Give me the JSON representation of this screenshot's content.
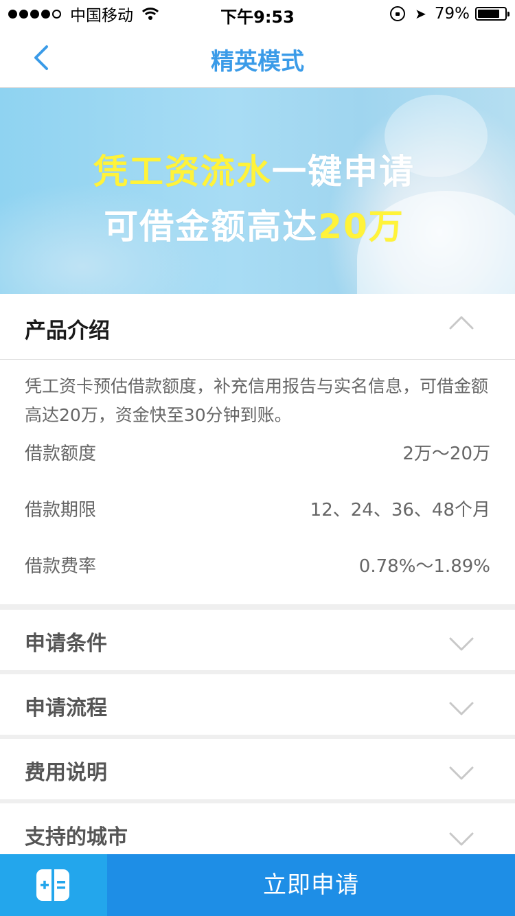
{
  "status_bar": {
    "carrier": "中国移动",
    "time": "下午9:53",
    "battery": "79%",
    "battery_level": 0.79,
    "signal_bars": 4
  },
  "nav": {
    "title": "精英模式"
  },
  "banner": {
    "line1_highlight": "凭工资流水",
    "line1_rest": "一键申请",
    "line2_main": "可借金额高达",
    "line2_highlight": "20万",
    "colors": {
      "highlight": "#fff33a",
      "text": "#ffffff"
    }
  },
  "intro": {
    "title": "产品介绍",
    "description": "凭工资卡预估借款额度，补充信用报告与实名信息，可借金额高达20万，资金快至30分钟到账。",
    "specs": [
      {
        "label": "借款额度",
        "value": "2万～20万"
      },
      {
        "label": "借款期限",
        "value": "12、24、36、48个月"
      },
      {
        "label": "借款费率",
        "value": "0.78%～1.89%"
      }
    ]
  },
  "sections": [
    {
      "title": "申请条件"
    },
    {
      "title": "申请流程"
    },
    {
      "title": "费用说明"
    },
    {
      "title": "支持的城市"
    }
  ],
  "bottom": {
    "apply_label": "立即申请"
  },
  "colors": {
    "accent": "#3a9be8",
    "apply_button": "#1e8ee6",
    "calc_button": "#23a6ec"
  }
}
